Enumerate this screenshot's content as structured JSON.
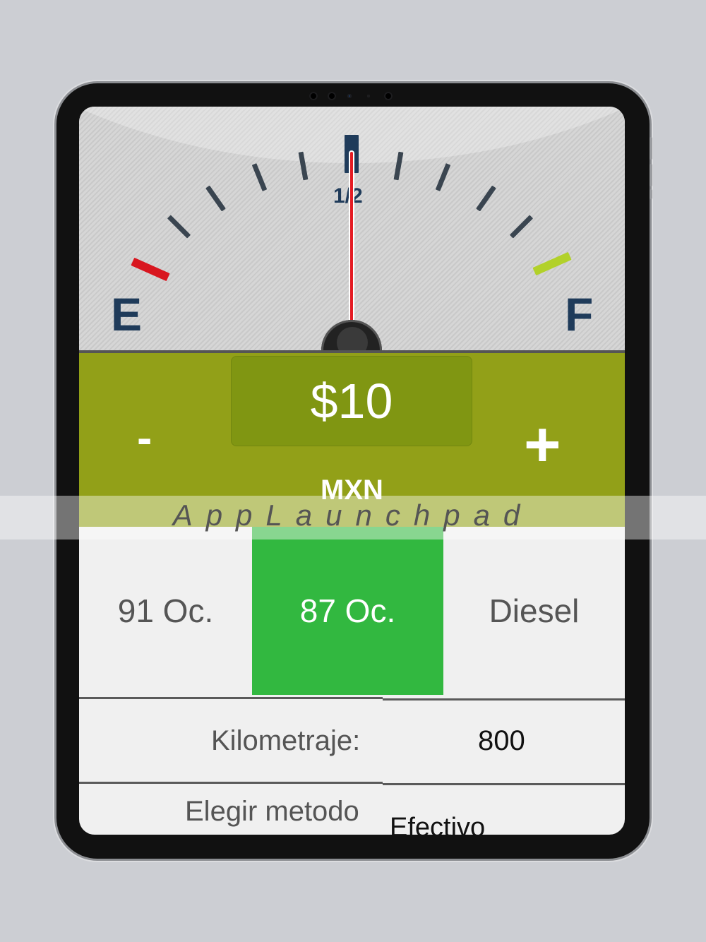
{
  "gauge": {
    "empty_label": "E",
    "full_label": "F",
    "half_label": "1/2",
    "needle_level": 0.5
  },
  "amount": {
    "value": "$10",
    "currency": "MXN",
    "decrease_label": "-",
    "increase_label": "+"
  },
  "fuel_types": [
    {
      "label": "91 Oc.",
      "selected": false
    },
    {
      "label": "87 Oc.",
      "selected": true
    },
    {
      "label": "Diesel",
      "selected": false
    }
  ],
  "mileage": {
    "label": "Kilometraje:",
    "value": "800"
  },
  "payment": {
    "label": "Elegir metodo",
    "value": "Efectivo"
  },
  "watermark": "AppLaunchpad",
  "colors": {
    "accent_green": "#32b840",
    "amount_bar": "#92a018",
    "needle": "#e41b23",
    "gauge_mark": "#1f3b5a"
  }
}
